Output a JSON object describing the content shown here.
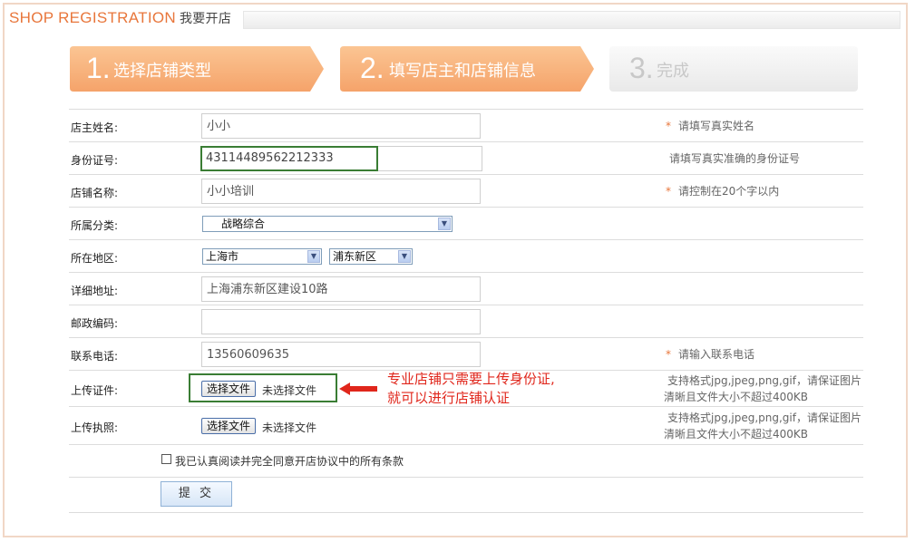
{
  "header": {
    "brand": "SHOP REGISTRATION",
    "subtitle": "我要开店"
  },
  "steps": [
    {
      "num": "1.",
      "label": "选择店铺类型",
      "state": "done"
    },
    {
      "num": "2.",
      "label": "填写店主和店铺信息",
      "state": "current"
    },
    {
      "num": "3.",
      "label": "完成",
      "state": "todo"
    }
  ],
  "colors": {
    "accent": "#e8763b",
    "step_active": "#f9b47d",
    "highlight": "#3a7d34",
    "note": "#e0261b"
  },
  "form": {
    "owner_name": {
      "label": "店主姓名:",
      "value": "小小",
      "hint": "请填写真实姓名",
      "required": true
    },
    "id_number": {
      "label": "身份证号:",
      "value": "43114489562212333",
      "hint": "请填写真实准确的身份证号"
    },
    "shop_name": {
      "label": "店铺名称:",
      "value": "小小培训",
      "hint": "请控制在20个字以内",
      "required": true
    },
    "category": {
      "label": "所属分类:",
      "selected": "战略综合"
    },
    "region": {
      "label": "所在地区:",
      "city": "上海市",
      "district": "浦东新区"
    },
    "address": {
      "label": "详细地址:",
      "value": "上海浦东新区建设10路"
    },
    "postcode": {
      "label": "邮政编码:",
      "value": ""
    },
    "phone": {
      "label": "联系电话:",
      "value": "13560609635",
      "hint": "请输入联系电话",
      "required": true
    },
    "id_upload": {
      "label": "上传证件:",
      "button": "选择文件",
      "status": "未选择文件",
      "hint_line1": "支持格式jpg,jpeg,png,gif，请保证图片",
      "hint_line2": "清晰且文件大小不超过400KB"
    },
    "license_upload": {
      "label": "上传执照:",
      "button": "选择文件",
      "status": "未选择文件",
      "hint_line1": "支持格式jpg,jpeg,png,gif，请保证图片",
      "hint_line2": "清晰且文件大小不超过400KB"
    },
    "annotation": {
      "line1": "专业店铺只需要上传身份证,",
      "line2": "就可以进行店铺认证"
    },
    "agree_text": "我已认真阅读并完全同意开店协议中的所有条款",
    "submit": "提 交",
    "required_mark": "*"
  }
}
